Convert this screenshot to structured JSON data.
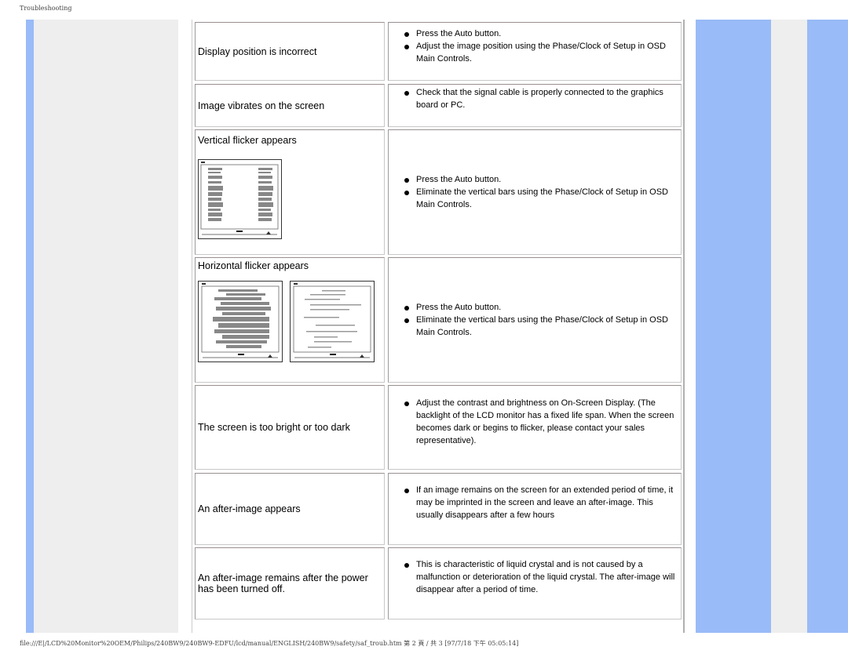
{
  "page_header": "Troubleshooting",
  "footer": "file:///E|/LCD%20Monitor%20OEM/Philips/240BW9/240BW9-EDFU/lcd/manual/ENGLISH/240BW9/safety/saf_troub.htm 第 2 頁 / 共 3 [97/7/18 下午 05:05:14]",
  "colors": {
    "side_blue": "#99bbf7",
    "side_gray": "#eeeeee"
  },
  "rows": [
    {
      "problem": "Display position is incorrect",
      "solutions": [
        "Press the Auto button.",
        "Adjust the image position using the Phase/Clock of Setup in OSD Main Controls."
      ]
    },
    {
      "problem": "Image vibrates on the screen",
      "solutions": [
        "Check that the signal cable is properly connected to the graphics board or PC."
      ]
    },
    {
      "problem": "Vertical flicker appears",
      "image": "vertical-flicker-screen",
      "solutions": [
        "Press the Auto button.",
        "Eliminate the vertical bars using the Phase/Clock of Setup in OSD Main Controls."
      ]
    },
    {
      "problem": "Horizontal flicker appears",
      "image": "horizontal-flicker-screens",
      "solutions": [
        "Press the Auto button.",
        "Eliminate the vertical bars using the Phase/Clock of Setup in OSD Main Controls."
      ]
    },
    {
      "problem": "The screen is too bright or too dark",
      "solutions": [
        "Adjust the contrast and brightness on On-Screen Display. (The backlight of the LCD monitor has a fixed life span. When the screen becomes dark or begins to flicker, please contact your sales representative)."
      ]
    },
    {
      "problem": "An after-image appears",
      "solutions": [
        "If an image remains on the screen for an extended period of time, it may be imprinted in the screen and leave an after-image. This usually disappears after a few hours"
      ]
    },
    {
      "problem": "An after-image remains after the power has been turned off.",
      "solutions": [
        "This is characteristic of liquid crystal and is not caused by a malfunction or deterioration of the liquid crystal. The after-image will disappear after a period of time."
      ]
    }
  ]
}
